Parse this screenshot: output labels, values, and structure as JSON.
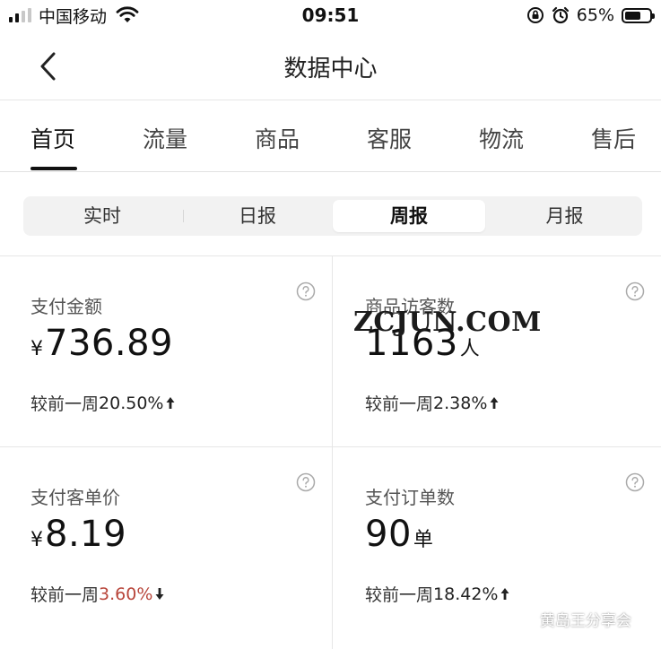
{
  "status_bar": {
    "carrier": "中国移动",
    "time": "09:51",
    "battery_percent": "65%",
    "battery_level": 0.65,
    "icons": [
      "signal-icon",
      "wifi-icon",
      "rotation-lock-icon",
      "alarm-icon",
      "battery-icon"
    ]
  },
  "nav": {
    "title": "数据中心",
    "back_icon": "chevron-left-icon"
  },
  "tabs": [
    {
      "label": "首页",
      "active": true
    },
    {
      "label": "流量",
      "active": false
    },
    {
      "label": "商品",
      "active": false
    },
    {
      "label": "客服",
      "active": false
    },
    {
      "label": "物流",
      "active": false
    },
    {
      "label": "售后",
      "active": false
    }
  ],
  "period_selector": [
    {
      "label": "实时",
      "active": false
    },
    {
      "label": "日报",
      "active": false
    },
    {
      "label": "周报",
      "active": true
    },
    {
      "label": "月报",
      "active": false
    }
  ],
  "metrics": [
    {
      "label": "支付金额",
      "currency": "¥",
      "value": "736.89",
      "unit": "",
      "compare_text": "较前一周",
      "change": "20.50%",
      "direction": "up"
    },
    {
      "label": "商品访客数",
      "currency": "",
      "value": "1163",
      "unit": "人",
      "compare_text": "较前一周",
      "change": "2.38%",
      "direction": "up"
    },
    {
      "label": "支付客单价",
      "currency": "¥",
      "value": "8.19",
      "unit": "",
      "compare_text": "较前一周",
      "change": "3.60%",
      "direction": "down"
    },
    {
      "label": "支付订单数",
      "currency": "",
      "value": "90",
      "unit": "单",
      "compare_text": "较前一周",
      "change": "18.42%",
      "direction": "up"
    }
  ],
  "colors": {
    "text_primary": "#111111",
    "text_secondary": "#555555",
    "down_color": "#b8453a",
    "divider": "#e6e6e6",
    "segment_bg": "#f2f2f2"
  },
  "watermarks": {
    "site": "ZCJUN.COM",
    "wechat": "黄岛王分享会"
  }
}
